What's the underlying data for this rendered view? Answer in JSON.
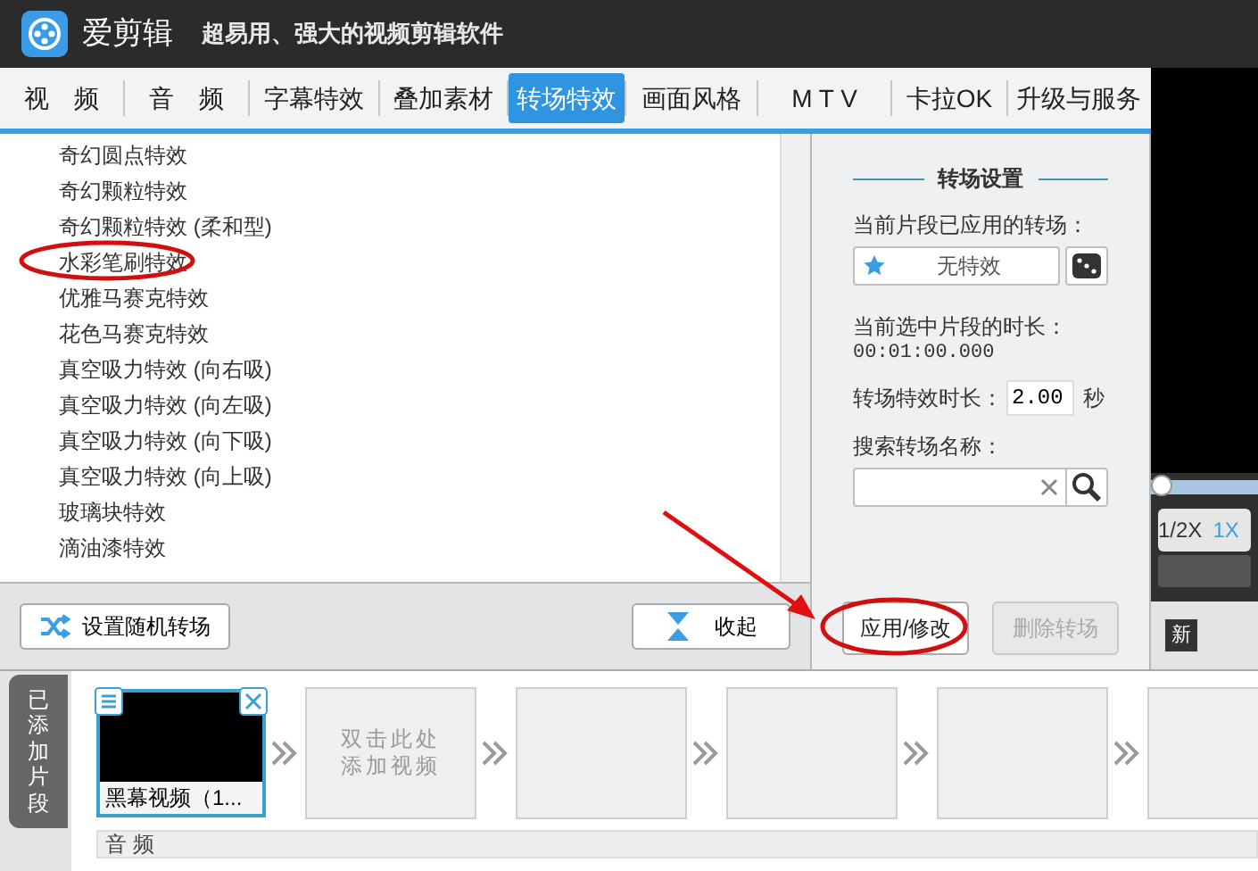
{
  "app": {
    "name": "爱剪辑",
    "slogan": "超易用、强大的视频剪辑软件"
  },
  "tabs": [
    {
      "label": "视　频",
      "selected": false
    },
    {
      "label": "音　频",
      "selected": false
    },
    {
      "label": "字幕特效",
      "selected": false
    },
    {
      "label": "叠加素材",
      "selected": false
    },
    {
      "label": "转场特效",
      "selected": true
    },
    {
      "label": "画面风格",
      "selected": false
    },
    {
      "label": "M T V",
      "selected": false
    },
    {
      "label": "卡拉OK",
      "selected": false
    },
    {
      "label": "升级与服务",
      "selected": false
    }
  ],
  "effects": [
    "奇幻圆点特效",
    "奇幻颗粒特效",
    "奇幻颗粒特效 (柔和型)",
    "水彩笔刷特效",
    "优雅马赛克特效",
    "花色马赛克特效",
    "真空吸力特效 (向右吸)",
    "真空吸力特效 (向左吸)",
    "真空吸力特效 (向下吸)",
    "真空吸力特效 (向上吸)",
    "玻璃块特效",
    "滴油漆特效"
  ],
  "list_toolbar": {
    "random_button": "设置随机转场",
    "collapse_button": "收起"
  },
  "settings": {
    "title": "转场设置",
    "applied_label": "当前片段已应用的转场：",
    "applied_value": "无特效",
    "duration_label": "当前选中片段的时长：",
    "duration_value": "00:01:00.000",
    "effect_duration_label": "转场特效时长：",
    "effect_duration_value": "2.00",
    "effect_duration_unit": "秒",
    "search_label": "搜索转场名称：",
    "apply_button": "应用/修改",
    "delete_button": {
      "label": "删除转场",
      "disabled": true
    }
  },
  "preview": {
    "progress": {
      "level": 0.0
    },
    "speeds": [
      {
        "label": "1/2X",
        "selected": false
      },
      {
        "label": "1X",
        "selected": true
      }
    ],
    "new_button": "新"
  },
  "timeline": {
    "side_tab": "已添加片段",
    "clips": [
      {
        "kind": "video",
        "label": "黑幕视频（1..."
      },
      {
        "kind": "add",
        "label_lines": [
          "双击此处",
          "添加视频"
        ]
      },
      {
        "kind": "empty"
      },
      {
        "kind": "empty"
      },
      {
        "kind": "empty"
      },
      {
        "kind": "empty"
      }
    ],
    "audio_label": "音 频"
  }
}
